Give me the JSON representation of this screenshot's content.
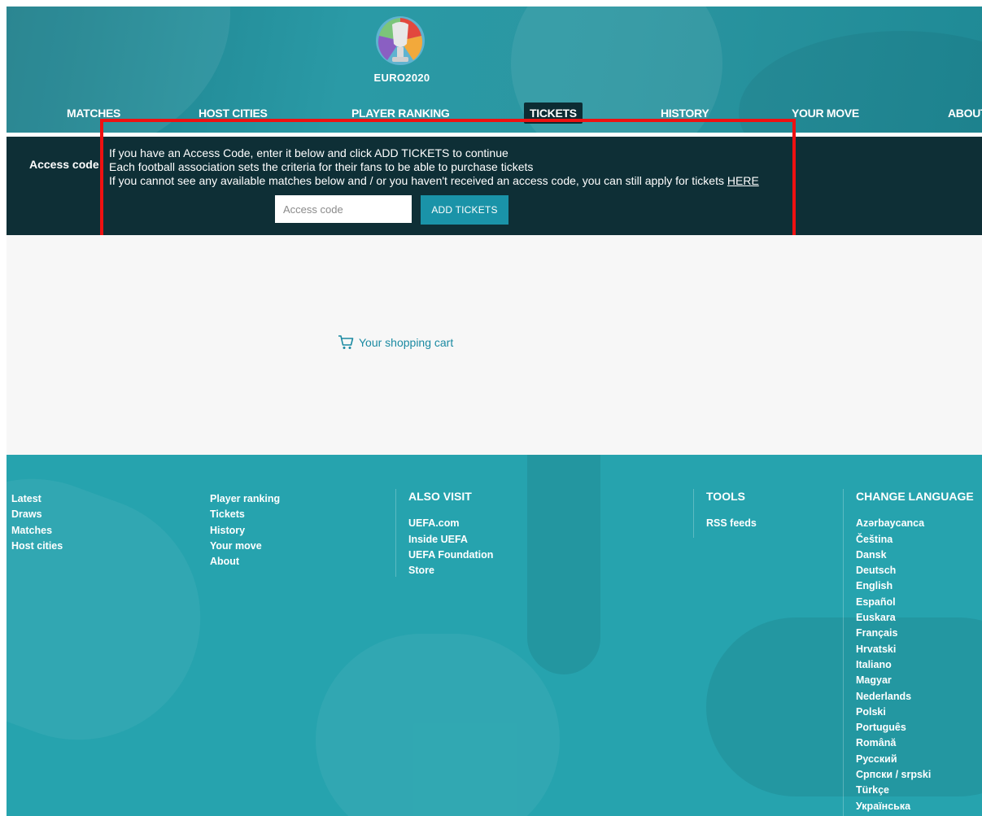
{
  "logo": {
    "text": "EURO2020"
  },
  "nav": [
    {
      "label": "MATCHES",
      "active": false
    },
    {
      "label": "HOST CITIES",
      "active": false
    },
    {
      "label": "PLAYER RANKING",
      "active": false
    },
    {
      "label": "TICKETS",
      "active": true
    },
    {
      "label": "HISTORY",
      "active": false
    },
    {
      "label": "YOUR MOVE",
      "active": false
    },
    {
      "label": "ABOUT",
      "active": false
    }
  ],
  "access": {
    "label": "Access code",
    "line1": "If you have an Access Code, enter it below and click ADD TICKETS to continue",
    "line2": "Each football association sets the criteria for their fans to be able to purchase tickets",
    "line3": "If you cannot see any available matches below and / or you haven't received an access code, you can still apply for tickets",
    "line3_link": "HERE",
    "input_value": "",
    "input_placeholder": "Access code",
    "button_label": "ADD TICKETS"
  },
  "cart": {
    "label": "Your shopping cart",
    "icon": "cart-icon"
  },
  "footer": {
    "col1": [
      "Latest",
      "Draws",
      "Matches",
      "Host cities"
    ],
    "col2": [
      "Player ranking",
      "Tickets",
      "History",
      "Your move",
      "About"
    ],
    "also_visit": {
      "heading": "ALSO VISIT",
      "items": [
        "UEFA.com",
        "Inside UEFA",
        "UEFA Foundation",
        "Store"
      ]
    },
    "tools": {
      "heading": "TOOLS",
      "items": [
        "RSS feeds"
      ]
    },
    "language": {
      "heading": "CHANGE LANGUAGE",
      "items": [
        "Azərbaycanca",
        "Čeština",
        "Dansk",
        "Deutsch",
        "English",
        "Español",
        "Euskara",
        "Français",
        "Hrvatski",
        "Italiano",
        "Magyar",
        "Nederlands",
        "Polski",
        "Português",
        "Română",
        "Русский",
        "Српски / srpski",
        "Türkçe",
        "Українська"
      ]
    }
  },
  "colors": {
    "header_teal": "#2a9aa6",
    "access_bar": "#0e2f36",
    "button": "#1a93a8",
    "footer": "#26a3ae",
    "highlight": "#ee1111"
  }
}
